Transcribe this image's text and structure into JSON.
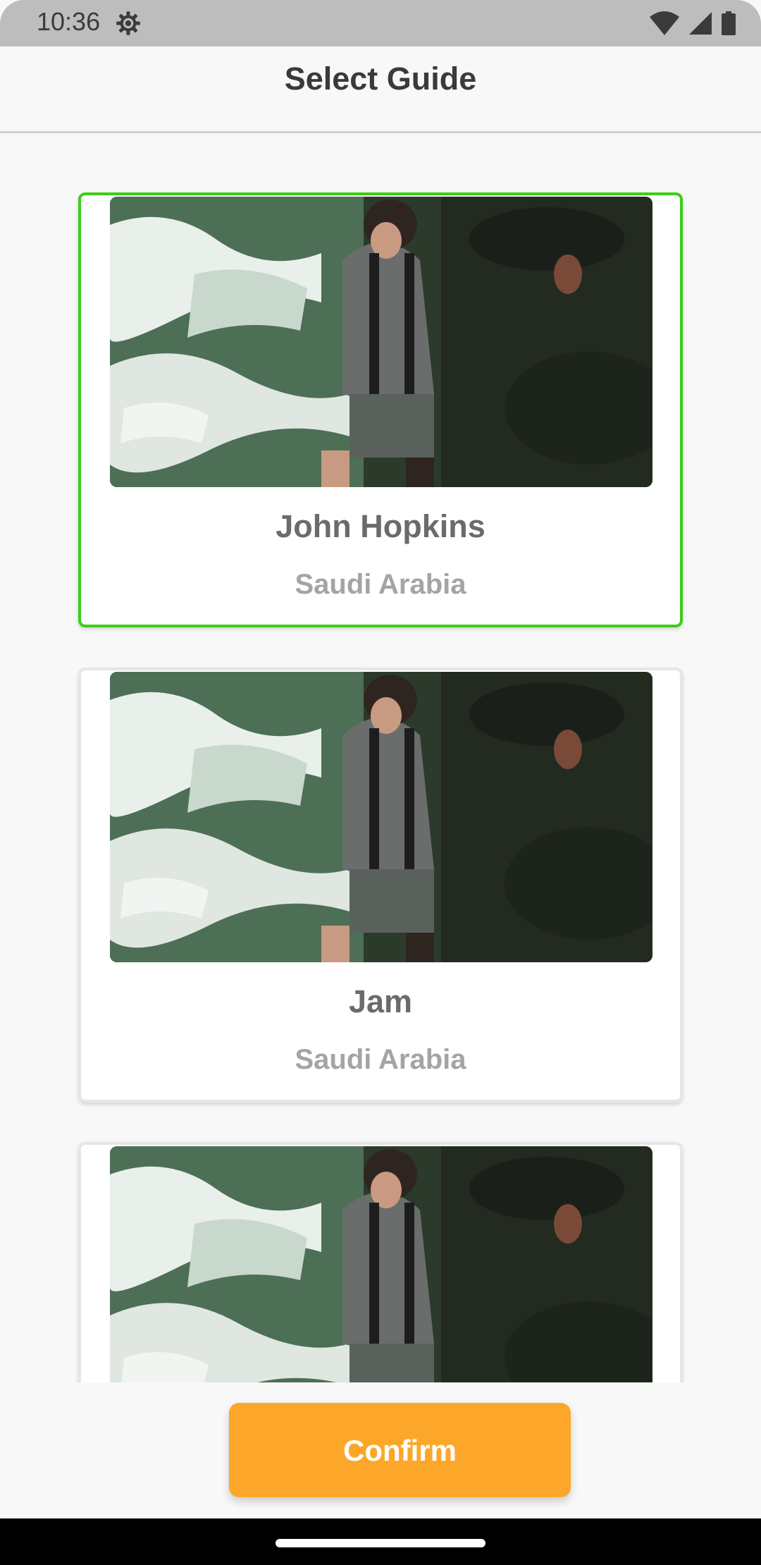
{
  "status_bar": {
    "time": "10:36",
    "icons": [
      "settings-gear-icon",
      "wifi-icon",
      "cellular-signal-icon",
      "battery-icon"
    ]
  },
  "header": {
    "title": "Select Guide"
  },
  "guides": [
    {
      "name": "John Hopkins",
      "country": "Saudi Arabia",
      "selected": true
    },
    {
      "name": "Jam",
      "country": "Saudi Arabia",
      "selected": false
    },
    {
      "name": "",
      "country": "",
      "selected": false
    }
  ],
  "footer": {
    "confirm_label": "Confirm"
  },
  "colors": {
    "accent": "#fda72a",
    "selected_border": "#3ccd18",
    "title_text": "#3a3a3a",
    "name_text": "#6b6b6b",
    "country_text": "#a4a4a4"
  }
}
